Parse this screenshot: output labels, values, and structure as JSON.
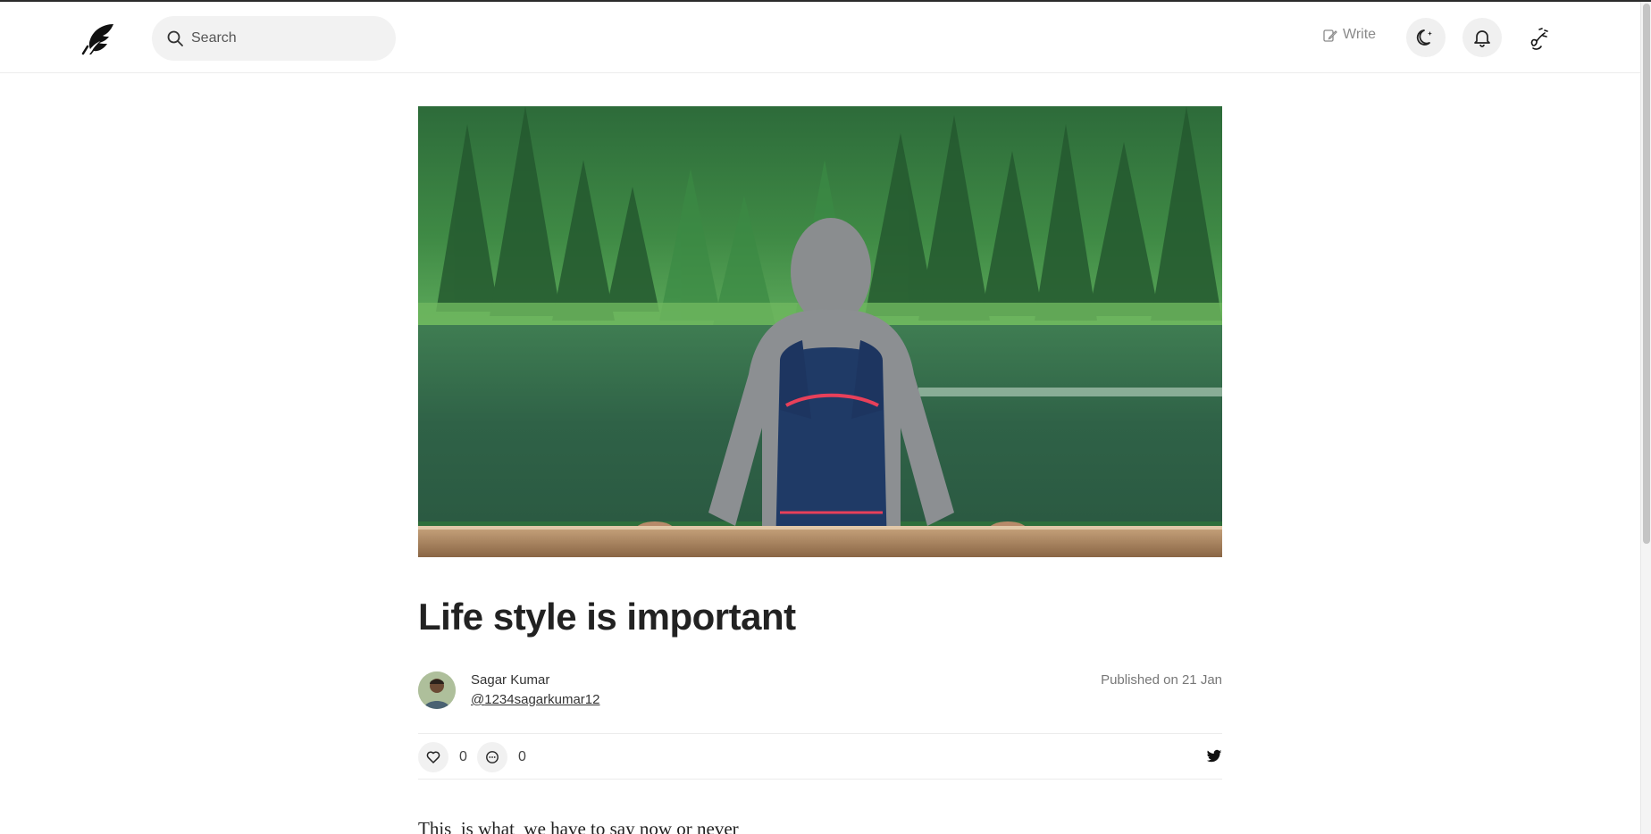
{
  "header": {
    "search": {
      "placeholder": "Search",
      "value": ""
    },
    "write_label": "Write",
    "icons": {
      "logo": "feather-logo-icon",
      "search": "search-icon",
      "write": "edit-icon",
      "theme": "moon-icon",
      "notifications": "bell-icon",
      "profile": "avatar-icon"
    }
  },
  "article": {
    "hero_image": "person-with-backpack-at-lake-forest",
    "title": "Life style is important",
    "author": {
      "name": "Sagar Kumar",
      "handle_prefix": "@",
      "handle": "1234sagarkumar12"
    },
    "published": "Published on 21 Jan",
    "likes": "0",
    "comments": "0",
    "share_icon": "twitter-icon",
    "body_first_line": "This  is what  we have to say now or never"
  },
  "colors": {
    "accent": "#222222",
    "muted": "#777777",
    "button_bg": "#f0f0f0"
  }
}
